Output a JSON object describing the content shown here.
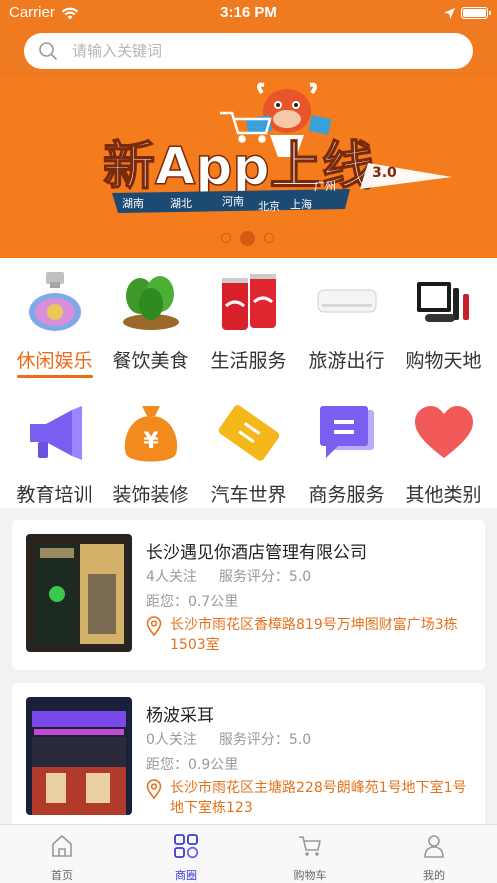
{
  "status_bar": {
    "carrier": "Carrier",
    "time": "3:16 PM"
  },
  "search": {
    "placeholder": "请输入关键词"
  },
  "banner": {
    "headline": "新App上线",
    "version": "3.0",
    "cities_left": [
      "湖南",
      "湖北",
      "河南"
    ],
    "cities_right": [
      "北京",
      "上海",
      "广州"
    ],
    "active_dot": 1,
    "dot_count": 3
  },
  "categories": {
    "row1": [
      {
        "label": "休闲娱乐",
        "icon": "perfume-icon",
        "active": true
      },
      {
        "label": "餐饮美食",
        "icon": "vegetables-icon"
      },
      {
        "label": "生活服务",
        "icon": "cola-cans-icon"
      },
      {
        "label": "旅游出行",
        "icon": "air-conditioner-icon"
      },
      {
        "label": "购物天地",
        "icon": "cosmetics-icon"
      }
    ],
    "row2": [
      {
        "label": "教育培训",
        "icon": "megaphone-icon"
      },
      {
        "label": "装饰装修",
        "icon": "money-bag-icon"
      },
      {
        "label": "汽车世界",
        "icon": "ticket-icon"
      },
      {
        "label": "商务服务",
        "icon": "chat-icon"
      },
      {
        "label": "其他类别",
        "icon": "heart-icon"
      }
    ]
  },
  "stores": [
    {
      "name": "长沙遇见你酒店管理有限公司",
      "followers": "4人关注",
      "score": "服务评分：5.0",
      "distance": "距您：0.7公里",
      "address": "长沙市雨花区香樟路819号万坤图财富广场3栋1503室"
    },
    {
      "name": "杨波采耳",
      "followers": "0人关注",
      "score": "服务评分：5.0",
      "distance": "距您：0.9公里",
      "address": "长沙市雨花区主塘路228号朗峰苑1号地下室1号地下室栋123"
    }
  ],
  "tabbar": [
    {
      "label": "首页",
      "icon": "home-icon"
    },
    {
      "label": "商圈",
      "icon": "grid-icon",
      "active": true
    },
    {
      "label": "购物车",
      "icon": "cart-icon"
    },
    {
      "label": "我的",
      "icon": "user-icon"
    }
  ],
  "colors": {
    "brand_orange": "#f07a1f",
    "accent": "#f06a18",
    "active_tab": "#3a3ad6",
    "address": "#e4711c"
  }
}
